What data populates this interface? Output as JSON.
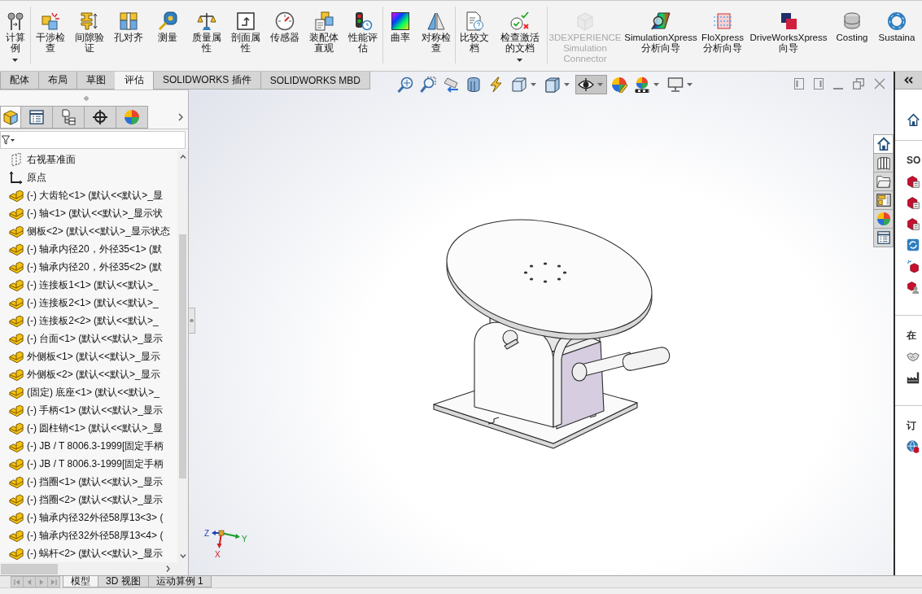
{
  "ribbon": {
    "groups": [
      {
        "items": [
          {
            "label": "计算例",
            "disabled": false,
            "dropdown": true
          }
        ]
      },
      {
        "items": [
          {
            "label": "干涉检查",
            "disabled": false,
            "dropdown": false
          },
          {
            "label": "间隙验证",
            "disabled": false,
            "dropdown": false
          },
          {
            "label": "孔对齐",
            "disabled": false,
            "dropdown": false
          },
          {
            "label": "测量",
            "disabled": false,
            "dropdown": false
          },
          {
            "label": "质量属性",
            "disabled": false,
            "dropdown": false
          },
          {
            "label": "剖面属性",
            "disabled": false,
            "dropdown": false
          },
          {
            "label": "传感器",
            "disabled": false,
            "dropdown": false
          },
          {
            "label": "装配体直观",
            "disabled": false,
            "dropdown": false
          },
          {
            "label": "性能评估",
            "disabled": false,
            "dropdown": false
          }
        ]
      },
      {
        "items": [
          {
            "label": "曲率",
            "disabled": false,
            "dropdown": false
          },
          {
            "label": "对称检查",
            "disabled": false,
            "dropdown": false
          }
        ]
      },
      {
        "items": [
          {
            "label": "比较文档",
            "disabled": false,
            "dropdown": false
          },
          {
            "label": "检查激活的文档",
            "disabled": false,
            "dropdown": true
          }
        ]
      },
      {
        "items": [
          {
            "label": "3DEXPERIENCE Simulation Connector",
            "disabled": true,
            "dropdown": false
          },
          {
            "label": "SimulationXpress 分析向导",
            "disabled": false,
            "dropdown": false
          },
          {
            "label": "FloXpress 分析向导",
            "disabled": false,
            "dropdown": false
          },
          {
            "label": "DriveWorksXpress 向导",
            "disabled": false,
            "dropdown": false
          },
          {
            "label": "Costing",
            "disabled": false,
            "dropdown": false
          },
          {
            "label": "Sustaina",
            "disabled": false,
            "dropdown": false
          }
        ]
      }
    ]
  },
  "command_tabs": [
    {
      "label": "配体",
      "selected": false
    },
    {
      "label": "布局",
      "selected": false
    },
    {
      "label": "草图",
      "selected": false
    },
    {
      "label": "评估",
      "selected": true
    },
    {
      "label": "SOLIDWORKS 插件",
      "selected": false
    },
    {
      "label": "SOLIDWORKS MBD",
      "selected": false
    }
  ],
  "feature_manager": {
    "tabs": [
      {
        "selected": true
      },
      {
        "selected": false
      },
      {
        "selected": false
      },
      {
        "selected": false
      },
      {
        "selected": false
      }
    ],
    "tree": [
      {
        "kind": "plane",
        "label": "右视基准面"
      },
      {
        "kind": "origin",
        "label": "原点"
      },
      {
        "kind": "part",
        "label": "(-) 大齿轮<1> (默认<<默认>_显"
      },
      {
        "kind": "part",
        "label": "(-) 轴<1> (默认<<默认>_显示状"
      },
      {
        "kind": "part",
        "label": "侧板<2> (默认<<默认>_显示状态"
      },
      {
        "kind": "part",
        "label": "(-) 轴承内径20，外径35<1> (默"
      },
      {
        "kind": "part",
        "label": "(-) 轴承内径20，外径35<2> (默"
      },
      {
        "kind": "part",
        "label": "(-) 连接板1<1> (默认<<默认>_"
      },
      {
        "kind": "part",
        "label": "(-) 连接板2<1> (默认<<默认>_"
      },
      {
        "kind": "part",
        "label": "(-) 连接板2<2> (默认<<默认>_"
      },
      {
        "kind": "part",
        "label": "(-) 台面<1> (默认<<默认>_显示"
      },
      {
        "kind": "part",
        "label": "外侧板<1> (默认<<默认>_显示"
      },
      {
        "kind": "part",
        "label": "外侧板<2> (默认<<默认>_显示"
      },
      {
        "kind": "part",
        "label": "(固定) 底座<1> (默认<<默认>_"
      },
      {
        "kind": "part",
        "label": "(-) 手柄<1> (默认<<默认>_显示"
      },
      {
        "kind": "part",
        "label": "(-) 圆柱销<1> (默认<<默认>_显"
      },
      {
        "kind": "part",
        "label": "(-) JB / T 8006.3-1999[固定手柄"
      },
      {
        "kind": "part",
        "label": "(-) JB / T 8006.3-1999[固定手柄"
      },
      {
        "kind": "part",
        "label": "(-) 挡圈<1> (默认<<默认>_显示"
      },
      {
        "kind": "part",
        "label": "(-) 挡圈<2> (默认<<默认>_显示"
      },
      {
        "kind": "part",
        "label": "(-) 轴承内径32外径58厚13<3> ("
      },
      {
        "kind": "part",
        "label": "(-) 轴承内径32外径58厚13<4> ("
      },
      {
        "kind": "part",
        "label": "(-) 蜗杆<2> (默认<<默认>_显示"
      }
    ]
  },
  "graphics": {
    "view_toolbar": [
      {
        "pressed": false,
        "dropdown": false
      },
      {
        "pressed": false,
        "dropdown": false
      },
      {
        "pressed": false,
        "dropdown": false
      },
      {
        "pressed": false,
        "dropdown": false
      },
      {
        "pressed": false,
        "dropdown": false
      },
      {
        "pressed": false,
        "dropdown": true
      },
      {
        "pressed": false,
        "dropdown": true
      },
      {
        "pressed": true,
        "dropdown": true
      },
      {
        "pressed": false,
        "dropdown": false
      },
      {
        "pressed": false,
        "dropdown": true
      },
      {
        "pressed": false,
        "dropdown": true
      }
    ],
    "triad": {
      "x": "X",
      "y": "Y",
      "z": "Z"
    }
  },
  "task_pane": {
    "tabs": [
      {
        "selected": true
      },
      {
        "selected": false
      },
      {
        "selected": false
      },
      {
        "selected": false
      },
      {
        "selected": false
      },
      {
        "selected": false
      }
    ],
    "sections": [
      {
        "title": "SO"
      },
      {
        "title": "在"
      },
      {
        "title": "订"
      }
    ]
  },
  "bottom_tabs": [
    {
      "label": "模型",
      "selected": true
    },
    {
      "label": "3D 视图",
      "selected": false
    },
    {
      "label": "运动算例 1",
      "selected": false
    }
  ]
}
